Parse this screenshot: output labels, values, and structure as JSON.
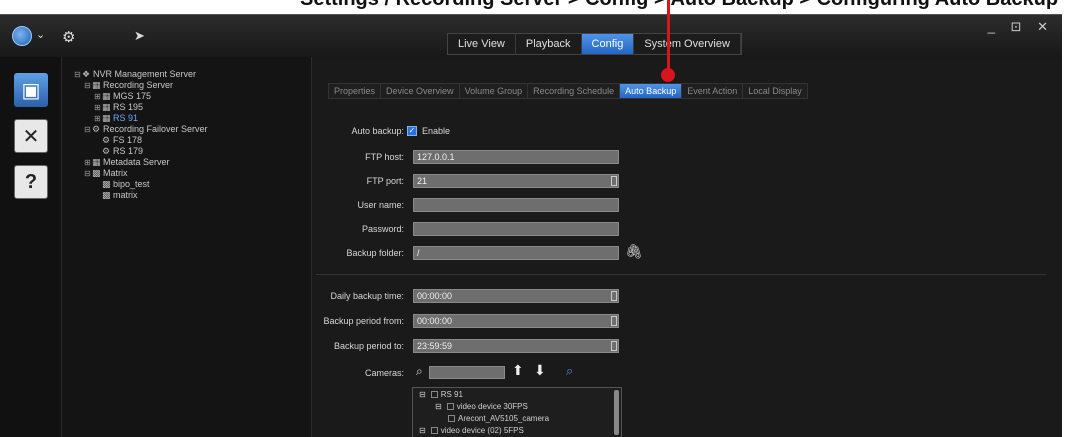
{
  "caption": "Settings / Recording Server > Config > Auto Backup > Configuring Auto Backup",
  "toolbar": {
    "tabs": [
      {
        "label": "Live View",
        "active": false
      },
      {
        "label": "Playback",
        "active": false
      },
      {
        "label": "Config",
        "active": true
      },
      {
        "label": "System Overview",
        "active": false
      }
    ],
    "window_controls": "_ ⊡ ✕"
  },
  "rail": {
    "monitor_icon": "monitor-icon",
    "settings_icon": "settings-tools-icon",
    "help_icon": "help-icon"
  },
  "tree": [
    {
      "label": "NVR Management Server",
      "indent": 0,
      "exp": "⊟",
      "icon": "❖"
    },
    {
      "label": "Recording Server",
      "indent": 1,
      "exp": "⊟",
      "icon": "▦"
    },
    {
      "label": "MGS 175",
      "indent": 2,
      "exp": "⊞",
      "icon": "▦"
    },
    {
      "label": "RS 195",
      "indent": 2,
      "exp": "⊞",
      "icon": "▦"
    },
    {
      "label": "RS 91",
      "indent": 2,
      "exp": "⊞",
      "icon": "▦",
      "selected": true
    },
    {
      "label": "Recording Failover Server",
      "indent": 1,
      "exp": "⊟",
      "icon": "⚙"
    },
    {
      "label": "FS 178",
      "indent": 2,
      "exp": "",
      "icon": "⚙"
    },
    {
      "label": "RS 179",
      "indent": 2,
      "exp": "",
      "icon": "⚙"
    },
    {
      "label": "Metadata Server",
      "indent": 1,
      "exp": "⊞",
      "icon": "▦"
    },
    {
      "label": "Matrix",
      "indent": 1,
      "exp": "⊟",
      "icon": "▩"
    },
    {
      "label": "bipo_test",
      "indent": 2,
      "exp": "",
      "icon": "▩"
    },
    {
      "label": "matrix",
      "indent": 2,
      "exp": "",
      "icon": "▩"
    }
  ],
  "subtabs": [
    {
      "label": "Properties",
      "active": false
    },
    {
      "label": "Device Overview",
      "active": false
    },
    {
      "label": "Volume Group",
      "active": false
    },
    {
      "label": "Recording Schedule",
      "active": false
    },
    {
      "label": "Auto Backup",
      "active": true
    },
    {
      "label": "Event Action",
      "active": false
    },
    {
      "label": "Local Display",
      "active": false
    }
  ],
  "form": {
    "auto_backup_label": "Auto backup:",
    "enable_label": "Enable",
    "enable_checked": true,
    "ftp_host_label": "FTP host:",
    "ftp_host_value": "127.0.0.1",
    "ftp_port_label": "FTP port:",
    "ftp_port_value": "21",
    "user_name_label": "User name:",
    "user_name_value": "",
    "password_label": "Password:",
    "password_value": "",
    "backup_folder_label": "Backup folder:",
    "backup_folder_value": "/",
    "daily_time_label": "Daily backup time:",
    "daily_time_value": "00:00:00",
    "period_from_label": "Backup period from:",
    "period_from_value": "00:00:00",
    "period_to_label": "Backup period to:",
    "period_to_value": "23:59:59",
    "cameras_label": "Cameras:"
  },
  "cameras": [
    {
      "label": "RS 91",
      "exp": "⊟"
    },
    {
      "label": "video device 30FPS",
      "exp": "⊟"
    },
    {
      "label": "Arecont_AV5105_camera",
      "exp": ""
    },
    {
      "label": "video device (02) 5FPS",
      "exp": "⊟"
    }
  ]
}
